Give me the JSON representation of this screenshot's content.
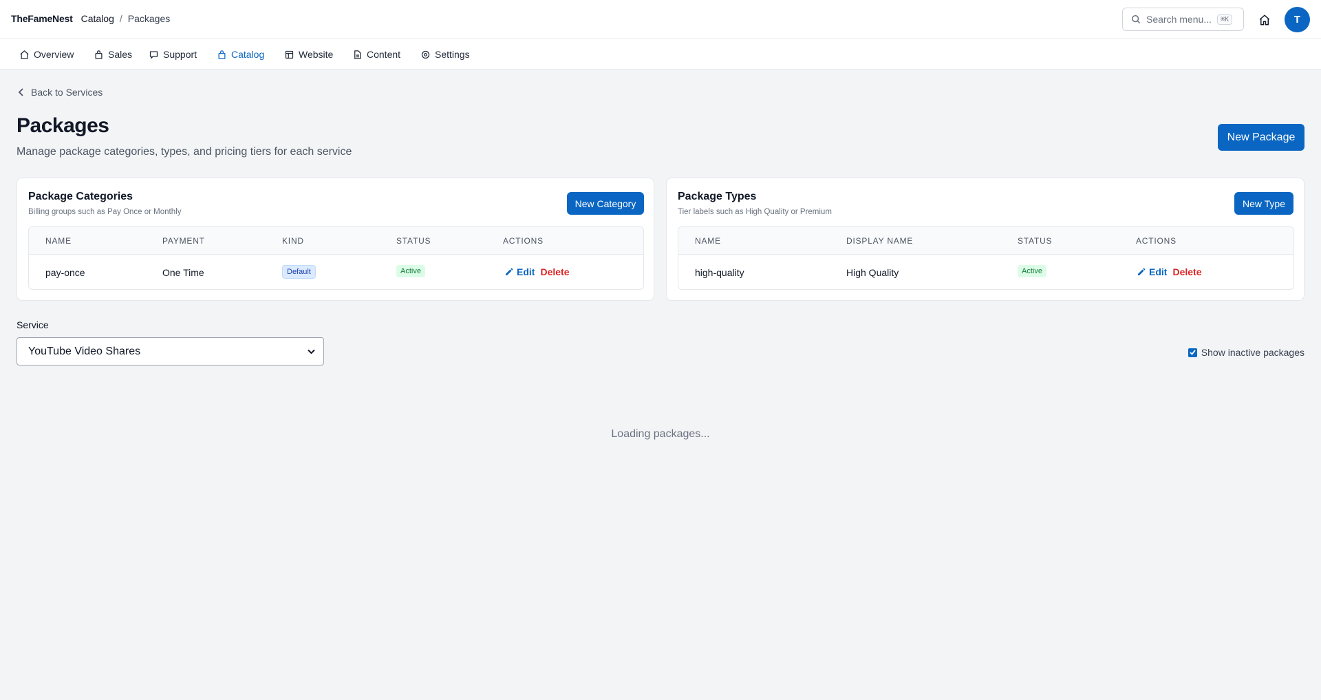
{
  "breadcrumb": {
    "brand": "TheFameNest",
    "section": "Catalog",
    "separator": "/",
    "current": "Packages"
  },
  "search": {
    "placeholder": "Search menu...",
    "shortcut": "⌘K",
    "icon": "search-icon"
  },
  "user": {
    "avatar_initial": "T"
  },
  "nav": {
    "items": [
      {
        "label": "Overview",
        "icon": "home-icon"
      },
      {
        "label": "Sales",
        "icon": "bag-icon"
      },
      {
        "label": "Support",
        "icon": "chat-icon"
      },
      {
        "label": "Catalog",
        "icon": "bag-icon",
        "active": true
      },
      {
        "label": "Website",
        "icon": "layout-icon"
      },
      {
        "label": "Content",
        "icon": "document-icon"
      },
      {
        "label": "Settings",
        "icon": "gear-icon"
      }
    ]
  },
  "page": {
    "back_label": "Back to Services",
    "title": "Packages",
    "subtitle": "Manage package categories, types, and pricing tiers for each service",
    "new_package_label": "New Package"
  },
  "categories": {
    "title": "Package Categories",
    "subtitle": "Billing groups such as Pay Once or Monthly",
    "new_label": "New Category",
    "headers": [
      "Name",
      "Payment",
      "Kind",
      "Status",
      "Actions"
    ],
    "rows": [
      {
        "name": "pay-once",
        "payment": "One Time",
        "kind": "Default",
        "status": "Active",
        "edit": "Edit",
        "delete": "Delete"
      }
    ]
  },
  "types": {
    "title": "Package Types",
    "subtitle": "Tier labels such as High Quality or Premium",
    "new_label": "New Type",
    "headers": [
      "Name",
      "Display Name",
      "Status",
      "Actions"
    ],
    "rows": [
      {
        "name": "high-quality",
        "display_name": "High Quality",
        "status": "Active",
        "edit": "Edit",
        "delete": "Delete"
      }
    ]
  },
  "service": {
    "label": "Service",
    "selected": "YouTube Video Shares",
    "show_inactive_label": "Show inactive packages",
    "show_inactive_checked": true
  },
  "status": {
    "loading": "Loading packages..."
  },
  "colors": {
    "accent": "#0a66c2",
    "danger": "#dc2626",
    "success_bg": "#dcfce7",
    "success_text": "#15803d"
  }
}
